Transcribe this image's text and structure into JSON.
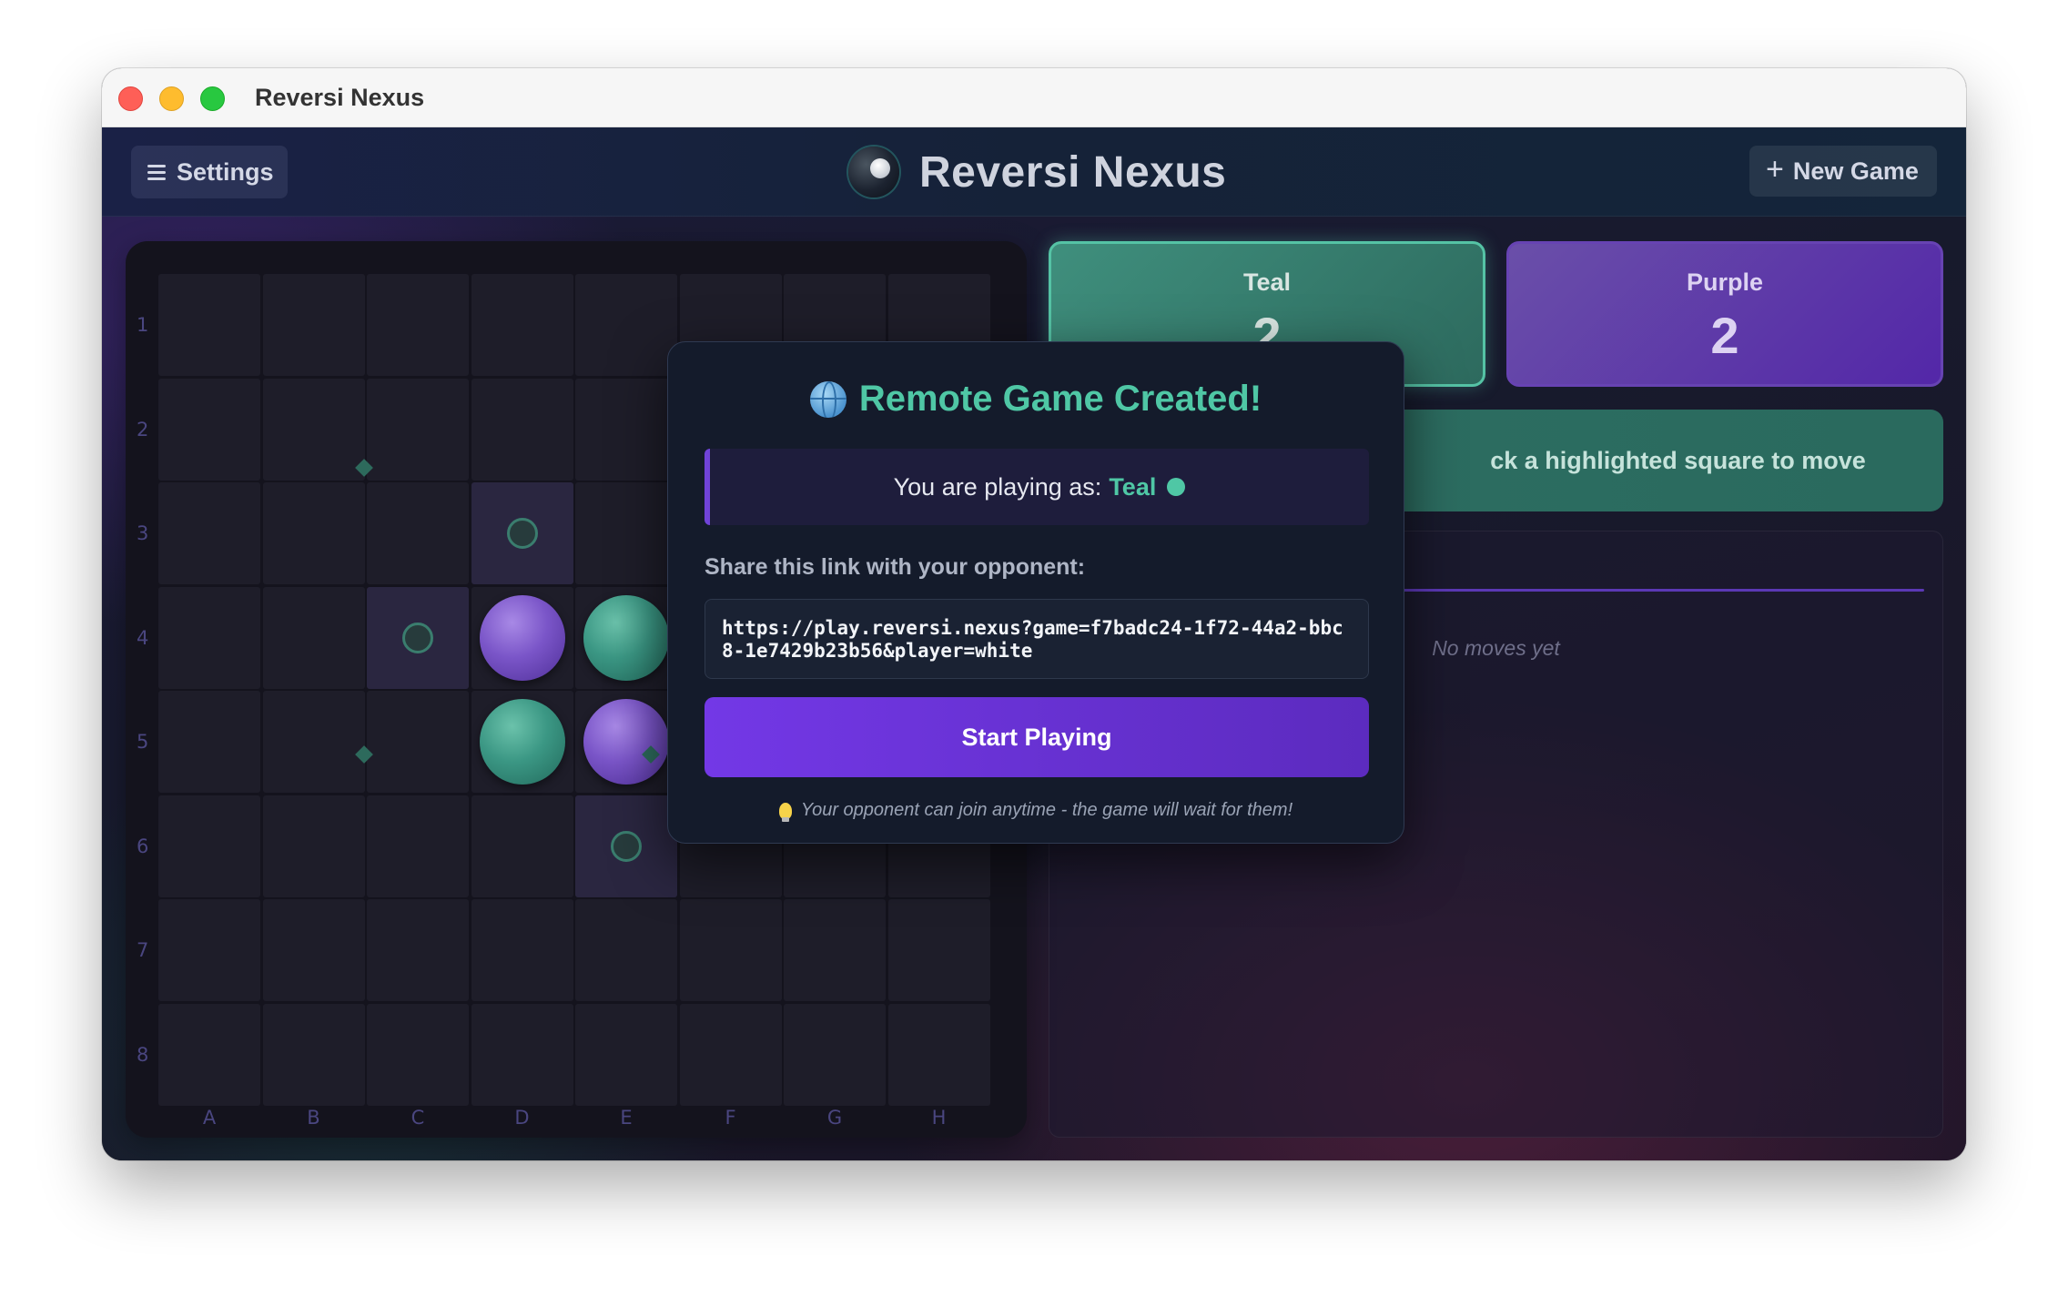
{
  "window": {
    "title": "Reversi Nexus"
  },
  "header": {
    "settings_label": "Settings",
    "brand_title": "Reversi Nexus",
    "new_game_label": "New Game"
  },
  "board": {
    "row_labels": [
      "1",
      "2",
      "3",
      "4",
      "5",
      "6",
      "7",
      "8"
    ],
    "col_labels": [
      "A",
      "B",
      "C",
      "D",
      "E",
      "F",
      "G",
      "H"
    ],
    "pieces": [
      {
        "cell": "D4",
        "color": "purple"
      },
      {
        "cell": "E4",
        "color": "teal"
      },
      {
        "cell": "D5",
        "color": "teal"
      },
      {
        "cell": "E5",
        "color": "purple"
      }
    ],
    "valid_moves": [
      "D3",
      "C4",
      "E6"
    ]
  },
  "scores": {
    "teal": {
      "name": "Teal",
      "value": "2",
      "color": "#4fc7a5"
    },
    "purple": {
      "name": "Purple",
      "value": "2",
      "color": "#6743b3"
    }
  },
  "status": {
    "message": "ck a highlighted square to move"
  },
  "moves": {
    "empty_text": "No moves yet"
  },
  "modal": {
    "title": "Remote Game Created!",
    "playing_as_prefix": "You are playing as:",
    "playing_as_color": "Teal",
    "share_label": "Share this link with your opponent:",
    "link": "https://play.reversi.nexus?game=f7badc24-1f72-44a2-bbc8-1e7429b23b56&player=white",
    "start_button": "Start Playing",
    "note": "Your opponent can join anytime - the game will wait for them!"
  },
  "colors": {
    "accent_teal": "#4fc7a5",
    "accent_purple": "#7338e6"
  }
}
